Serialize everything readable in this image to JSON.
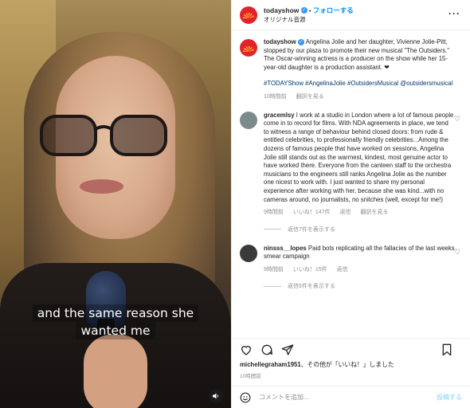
{
  "video": {
    "caption_line1": "and the same reason she",
    "caption_line2": "wanted me",
    "mute_icon": "speaker-icon"
  },
  "header": {
    "username": "todayshow",
    "verified_mark": "✓",
    "follow_label": "フォローする",
    "separator": "•",
    "subtitle": "オリジナル音源",
    "more_icon": "more-icon",
    "more_glyph": "···"
  },
  "caption": {
    "username": "todayshow",
    "verified_mark": "✓",
    "text": "Angelina Jolie and her daughter, Vivienne Jolie-Pitt, stopped by our plaza to promote their new musical \"The Outsiders.\" The Oscar-winning actress is a producer on the show while her 15-year-old daughter is a production assistant. ❤",
    "tags": "#TODAYShow #AngelinaJolie #OutsidersMusical @outsidersmusical",
    "time": "10時間前",
    "translate": "翻訳を見る"
  },
  "comments": [
    {
      "username": "gracemlsy",
      "text": "I work at a studio in London where a lot of famous people come in to record for films. With NDA agreements in place, we tend to witness a range of behaviour behind closed doors: from rude & entitled celebrities, to professionally friendly celebrities...Among the dozens of famous people that have worked on sessions, Angelina Jolie still stands out as the warmest, kindest, most genuine actor to have worked there. Everyone from the canteen staff to the orchestra musicians to the engineers still ranks Angelina Jolie as the number one nicest to work with. I just wanted to share my personal experience after working with her, because she was kind...with no cameras around, no journalists, no snitches (well, except for me!)",
      "time": "9時間前",
      "likes": "いいね！147件",
      "reply": "返信",
      "translate": "翻訳を見る",
      "replies": "返信7件を表示する",
      "avatar_color": "#7d8a8c"
    },
    {
      "username": "ninsss__lopes",
      "text": "Paid bots replicating all the fallacies of the last weeks smear campaign",
      "time": "9時間前",
      "likes": "いいね！15件",
      "reply": "返信",
      "translate": "",
      "replies": "返信6件を表示する",
      "avatar_color": "#3a3a3a"
    }
  ],
  "actions": {
    "like_icon": "heart-icon",
    "comment_icon": "comment-icon",
    "share_icon": "share-icon",
    "save_icon": "bookmark-icon"
  },
  "likes_line": {
    "user": "michellegraham1951",
    "rest": "、その他が「いいね！」しました"
  },
  "time": "10時間前",
  "comment_box": {
    "placeholder": "コメントを追加...",
    "post_label": "投稿する",
    "emoji_icon": "emoji-icon"
  }
}
